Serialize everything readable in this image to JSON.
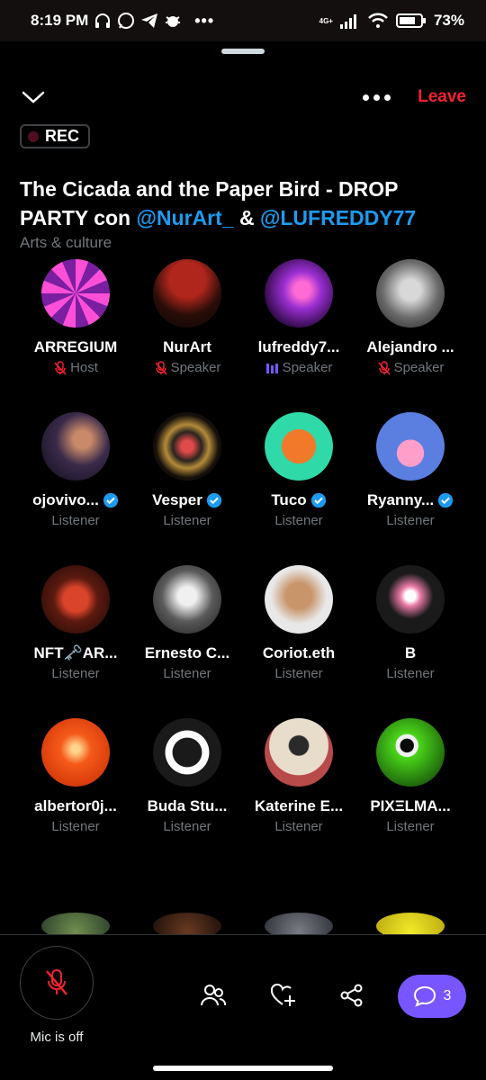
{
  "status_bar": {
    "time": "8:19 PM",
    "network": "4G+",
    "battery": "73%"
  },
  "header": {
    "leave_label": "Leave",
    "rec_label": "REC"
  },
  "space": {
    "title_part1": "The Cicada and the Paper Bird - DROP PARTY con ",
    "mention1": "@NurArt_",
    "title_part2": " & ",
    "mention2": "@LUFREDDY77",
    "category": "Arts & culture"
  },
  "participants": [
    {
      "name": "ARREGIUM",
      "role": "Host",
      "status": "muted",
      "verified": false
    },
    {
      "name": "NurArt",
      "role": "Speaker",
      "status": "muted",
      "verified": false
    },
    {
      "name": "lufreddy7...",
      "role": "Speaker",
      "status": "speaking",
      "verified": false
    },
    {
      "name": "Alejandro ...",
      "role": "Speaker",
      "status": "muted",
      "verified": false
    },
    {
      "name": "ojovivo...",
      "role": "Listener",
      "status": "none",
      "verified": true
    },
    {
      "name": "Vesper",
      "role": "Listener",
      "status": "none",
      "verified": true
    },
    {
      "name": "Tuco",
      "role": "Listener",
      "status": "none",
      "verified": true
    },
    {
      "name": "Ryanny...",
      "role": "Listener",
      "status": "none",
      "verified": true
    },
    {
      "name": "NFT🗝️AR...",
      "role": "Listener",
      "status": "none",
      "verified": false
    },
    {
      "name": "Ernesto C...",
      "role": "Listener",
      "status": "none",
      "verified": false
    },
    {
      "name": "Coriot.eth",
      "role": "Listener",
      "status": "none",
      "verified": false
    },
    {
      "name": "B",
      "role": "Listener",
      "status": "none",
      "verified": false
    },
    {
      "name": "albertor0j...",
      "role": "Listener",
      "status": "none",
      "verified": false
    },
    {
      "name": "Buda Stu...",
      "role": "Listener",
      "status": "none",
      "verified": false
    },
    {
      "name": "Katerine E...",
      "role": "Listener",
      "status": "none",
      "verified": false
    },
    {
      "name": "PIXΞLMA...",
      "role": "Listener",
      "status": "none",
      "verified": false
    }
  ],
  "bottom": {
    "mic_label": "Mic is off",
    "comments_count": "3"
  },
  "colors": {
    "accent_blue": "#1d9bf0",
    "leave_red": "#f4212e",
    "chat_purple": "#7856ff",
    "speaking_purple": "#7856ff",
    "muted_red": "#f4212e"
  }
}
